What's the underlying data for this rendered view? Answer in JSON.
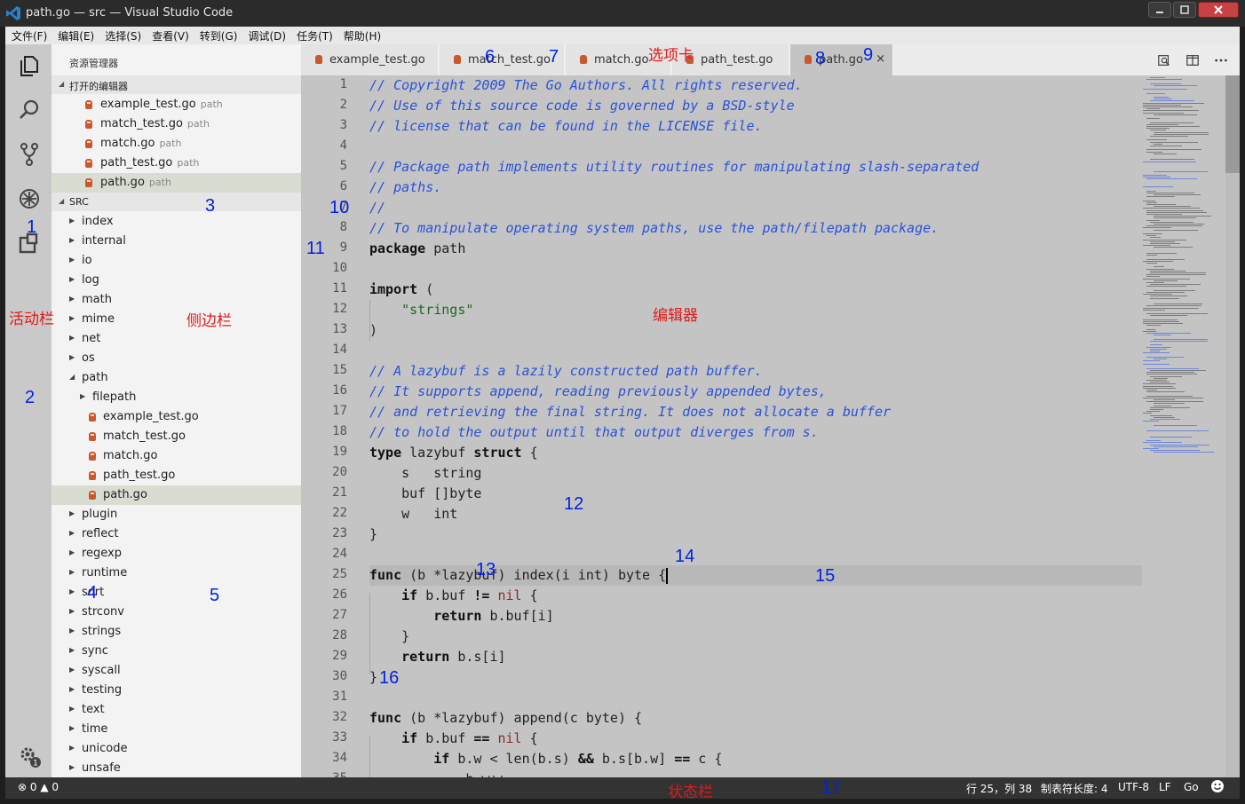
{
  "window": {
    "title": "path.go — src — Visual Studio Code"
  },
  "menu": [
    "文件(F)",
    "编辑(E)",
    "选择(S)",
    "查看(V)",
    "转到(G)",
    "调试(D)",
    "任务(T)",
    "帮助(H)"
  ],
  "sidebar": {
    "title": "资源管理器",
    "open_editors_label": "打开的编辑器",
    "open_editors": [
      {
        "name": "example_test.go",
        "desc": "path"
      },
      {
        "name": "match_test.go",
        "desc": "path"
      },
      {
        "name": "match.go",
        "desc": "path"
      },
      {
        "name": "path_test.go",
        "desc": "path"
      },
      {
        "name": "path.go",
        "desc": "path"
      }
    ],
    "folder_label": "SRC",
    "tree": [
      {
        "name": "index",
        "kind": "folder",
        "depth": 0
      },
      {
        "name": "internal",
        "kind": "folder",
        "depth": 0
      },
      {
        "name": "io",
        "kind": "folder",
        "depth": 0
      },
      {
        "name": "log",
        "kind": "folder",
        "depth": 0
      },
      {
        "name": "math",
        "kind": "folder",
        "depth": 0
      },
      {
        "name": "mime",
        "kind": "folder",
        "depth": 0
      },
      {
        "name": "net",
        "kind": "folder",
        "depth": 0
      },
      {
        "name": "os",
        "kind": "folder",
        "depth": 0
      },
      {
        "name": "path",
        "kind": "folder-open",
        "depth": 0
      },
      {
        "name": "filepath",
        "kind": "folder",
        "depth": 1
      },
      {
        "name": "example_test.go",
        "kind": "file",
        "depth": 1
      },
      {
        "name": "match_test.go",
        "kind": "file",
        "depth": 1
      },
      {
        "name": "match.go",
        "kind": "file",
        "depth": 1
      },
      {
        "name": "path_test.go",
        "kind": "file",
        "depth": 1
      },
      {
        "name": "path.go",
        "kind": "file",
        "depth": 1,
        "selected": true
      },
      {
        "name": "plugin",
        "kind": "folder",
        "depth": 0
      },
      {
        "name": "reflect",
        "kind": "folder",
        "depth": 0
      },
      {
        "name": "regexp",
        "kind": "folder",
        "depth": 0
      },
      {
        "name": "runtime",
        "kind": "folder",
        "depth": 0
      },
      {
        "name": "sort",
        "kind": "folder",
        "depth": 0
      },
      {
        "name": "strconv",
        "kind": "folder",
        "depth": 0
      },
      {
        "name": "strings",
        "kind": "folder",
        "depth": 0
      },
      {
        "name": "sync",
        "kind": "folder",
        "depth": 0
      },
      {
        "name": "syscall",
        "kind": "folder",
        "depth": 0
      },
      {
        "name": "testing",
        "kind": "folder",
        "depth": 0
      },
      {
        "name": "text",
        "kind": "folder",
        "depth": 0
      },
      {
        "name": "time",
        "kind": "folder",
        "depth": 0
      },
      {
        "name": "unicode",
        "kind": "folder",
        "depth": 0
      },
      {
        "name": "unsafe",
        "kind": "folder",
        "depth": 0
      }
    ]
  },
  "tabs": [
    {
      "name": "example_test.go"
    },
    {
      "name": "match_test.go"
    },
    {
      "name": "match.go"
    },
    {
      "name": "path_test.go"
    },
    {
      "name": "path.go",
      "active": true,
      "close": "×"
    }
  ],
  "editor": {
    "cursor_line": 25,
    "lines": [
      [
        [
          "c",
          "// Copyright 2009 The Go Authors. All rights reserved."
        ]
      ],
      [
        [
          "c",
          "// Use of this source code is governed by a BSD-style"
        ]
      ],
      [
        [
          "c",
          "// license that can be found in the LICENSE file."
        ]
      ],
      [],
      [
        [
          "c",
          "// Package path implements utility routines for manipulating slash-separated"
        ]
      ],
      [
        [
          "c",
          "// paths."
        ]
      ],
      [
        [
          "c",
          "//"
        ]
      ],
      [
        [
          "c",
          "// To manipulate operating system paths, use the path/filepath package."
        ]
      ],
      [
        [
          "k",
          "package"
        ],
        [
          "t",
          " path"
        ]
      ],
      [],
      [
        [
          "k",
          "import"
        ],
        [
          "t",
          " ("
        ]
      ],
      [
        [
          "t",
          "    "
        ],
        [
          "s",
          "\"strings\""
        ]
      ],
      [
        [
          "t",
          ")"
        ]
      ],
      [],
      [
        [
          "c",
          "// A lazybuf is a lazily constructed path buffer."
        ]
      ],
      [
        [
          "c",
          "// It supports append, reading previously appended bytes,"
        ]
      ],
      [
        [
          "c",
          "// and retrieving the final string. It does not allocate a buffer"
        ]
      ],
      [
        [
          "c",
          "// to hold the output until that output diverges from s."
        ]
      ],
      [
        [
          "k",
          "type"
        ],
        [
          "t",
          " lazybuf "
        ],
        [
          "k",
          "struct"
        ],
        [
          "t",
          " {"
        ]
      ],
      [
        [
          "t",
          "    s   string"
        ]
      ],
      [
        [
          "t",
          "    buf []byte"
        ]
      ],
      [
        [
          "t",
          "    w   int"
        ]
      ],
      [
        [
          "t",
          "}"
        ]
      ],
      [],
      [
        [
          "k",
          "func"
        ],
        [
          "t",
          " (b *lazybuf) index(i int) byte {"
        ],
        [
          "caret",
          ""
        ]
      ],
      [
        [
          "t",
          "    "
        ],
        [
          "k",
          "if"
        ],
        [
          "t",
          " b.buf "
        ],
        [
          "k",
          "!="
        ],
        [
          "t",
          " "
        ],
        [
          "n",
          "nil"
        ],
        [
          "t",
          " {"
        ]
      ],
      [
        [
          "t",
          "        "
        ],
        [
          "k",
          "return"
        ],
        [
          "t",
          " b.buf[i]"
        ]
      ],
      [
        [
          "t",
          "    }"
        ]
      ],
      [
        [
          "t",
          "    "
        ],
        [
          "k",
          "return"
        ],
        [
          "t",
          " b.s[i]"
        ]
      ],
      [
        [
          "t",
          "}"
        ]
      ],
      [],
      [
        [
          "k",
          "func"
        ],
        [
          "t",
          " (b *lazybuf) append(c byte) {"
        ]
      ],
      [
        [
          "t",
          "    "
        ],
        [
          "k",
          "if"
        ],
        [
          "t",
          " b.buf "
        ],
        [
          "k",
          "=="
        ],
        [
          "t",
          " "
        ],
        [
          "n",
          "nil"
        ],
        [
          "t",
          " {"
        ]
      ],
      [
        [
          "t",
          "        "
        ],
        [
          "k",
          "if"
        ],
        [
          "t",
          " b.w < len(b.s) "
        ],
        [
          "k",
          "&&"
        ],
        [
          "t",
          " b.s[b.w] "
        ],
        [
          "k",
          "=="
        ],
        [
          "t",
          " c {"
        ]
      ],
      [
        [
          "t",
          "            b.w++"
        ]
      ]
    ]
  },
  "status": {
    "errors": "0",
    "warnings": "0",
    "position": "行 25，列 38",
    "tab_size": "制表符长度: 4",
    "encoding": "UTF-8",
    "eol": "LF",
    "language": "Go"
  },
  "annotations": {
    "blue": [
      "1",
      "2",
      "3",
      "4",
      "5",
      "6",
      "7",
      "8",
      "9",
      "10",
      "11",
      "12",
      "13",
      "14",
      "15",
      "16",
      "17"
    ],
    "red": {
      "activity_bar": "活动栏",
      "sidebar": "侧边栏",
      "tabs": "选项卡",
      "editor": "编辑器",
      "status_bar": "状态栏"
    }
  },
  "colors": {
    "comment": "#2a52d8",
    "accent_red": "#e01a1a",
    "annotation_blue": "#0022dd",
    "statusbar": "#333333"
  }
}
